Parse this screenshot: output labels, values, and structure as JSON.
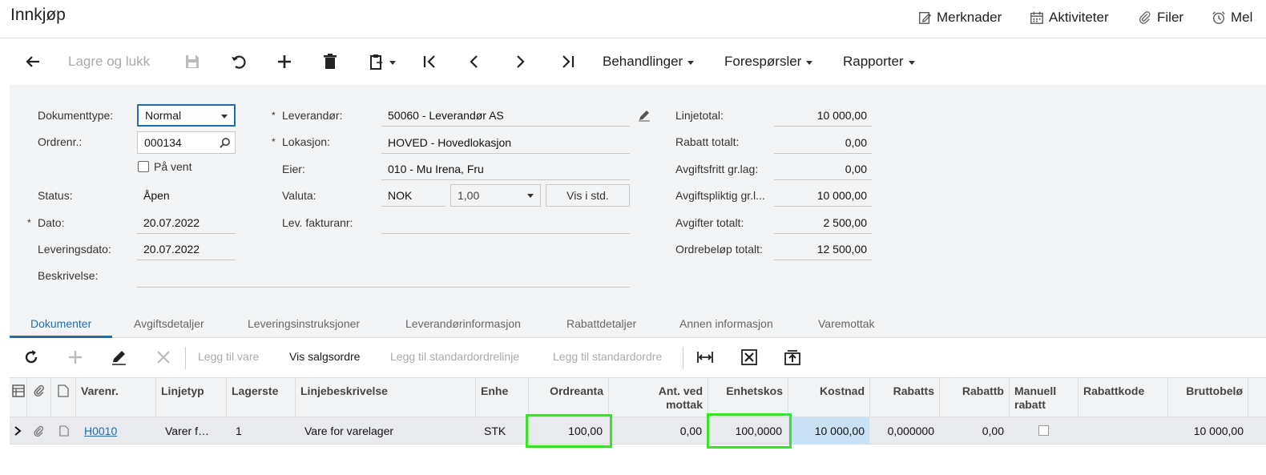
{
  "header": {
    "title": "Innkjøp",
    "links": {
      "notes": "Merknader",
      "activities": "Aktiviteter",
      "files": "Filer",
      "reminders": "Mel"
    }
  },
  "toolbar": {
    "save_close": "Lagre og lukk",
    "actions": "Behandlinger",
    "inquiries": "Forespørsler",
    "reports": "Rapporter"
  },
  "form": {
    "doc_type_label": "Dokumenttype:",
    "doc_type_value": "Normal",
    "order_nr_label": "Ordrenr.:",
    "order_nr_value": "000134",
    "on_hold_label": "På vent",
    "status_label": "Status:",
    "status_value": "Åpen",
    "date_label": "Dato:",
    "date_value": "20.07.2022",
    "delivery_date_label": "Leveringsdato:",
    "delivery_date_value": "20.07.2022",
    "description_label": "Beskrivelse:",
    "description_value": "",
    "vendor_label": "Leverandør:",
    "vendor_value": "50060 - Leverandør AS",
    "location_label": "Lokasjon:",
    "location_value": "HOVED - Hovedlokasjon",
    "owner_label": "Eier:",
    "owner_value": "010 - Mu Irena, Fru",
    "currency_label": "Valuta:",
    "currency_value": "NOK",
    "rate_value": "1,00",
    "show_std_label": "Vis i std.",
    "vendor_invoice_label": "Lev. fakturanr:",
    "vendor_invoice_value": "",
    "line_total_label": "Linjetotal:",
    "line_total_value": "10 000,00",
    "discount_total_label": "Rabatt totalt:",
    "discount_total_value": "0,00",
    "taxfree_base_label": "Avgiftsfritt gr.lag:",
    "taxfree_base_value": "0,00",
    "taxable_base_label": "Avgiftspliktig gr.l...",
    "taxable_base_value": "10 000,00",
    "tax_total_label": "Avgifter totalt:",
    "tax_total_value": "2 500,00",
    "order_total_label": "Ordrebeløp totalt:",
    "order_total_value": "12 500,00"
  },
  "tabs": [
    "Dokumenter",
    "Avgiftsdetaljer",
    "Leveringsinstruksjoner",
    "Leverandørinformasjon",
    "Rabattdetaljer",
    "Annen informasjon",
    "Varemottak"
  ],
  "grid_toolbar": {
    "add_item": "Legg til vare",
    "show_sales_order": "Vis salgsordre",
    "add_std_line": "Legg til standardordrelinje",
    "add_std_order": "Legg til standardordre"
  },
  "columns": {
    "item_nr": "Varenr.",
    "line_type": "Linjetyp",
    "warehouse": "Lagerste",
    "line_desc": "Linjebeskrivelse",
    "unit": "Enhe",
    "order_qty": "Ordreanta",
    "recv_qty_1": "Ant. ved",
    "recv_qty_2": "mottak",
    "unit_cost": "Enhetskos",
    "cost": "Kostnad",
    "discount_pct": "Rabatts",
    "discount_amt": "Rabattb",
    "manual_disc_1": "Manuell",
    "manual_disc_2": "rabatt",
    "discount_code": "Rabattkode",
    "gross_amount": "Bruttobelø"
  },
  "rows": [
    {
      "item_nr": "H0010",
      "line_type": "Varer f…",
      "warehouse": "1",
      "line_desc": "Vare for varelager",
      "unit": "STK",
      "order_qty": "100,00",
      "recv_qty": "0,00",
      "unit_cost": "100,0000",
      "cost": "10 000,00",
      "discount_pct": "0,000000",
      "discount_amt": "0,00",
      "manual_disc": false,
      "discount_code": "",
      "gross_amount": "10 000,00"
    }
  ],
  "colors": {
    "accent": "#1a6fb5",
    "highlight": "#3be02a",
    "selected_cell": "#c9e1f5"
  }
}
